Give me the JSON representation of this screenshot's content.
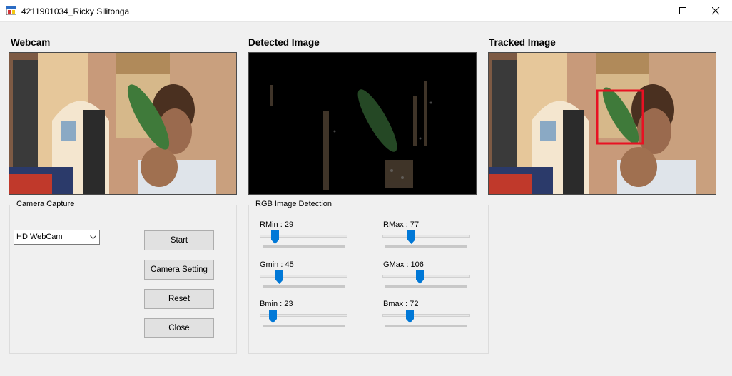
{
  "window": {
    "title": "4211901034_Ricky Silitonga",
    "controls": [
      "minimize-icon",
      "maximize-icon",
      "close-icon"
    ]
  },
  "sections": {
    "webcam": "Webcam",
    "detected": "Detected Image",
    "tracked": "Tracked Image"
  },
  "camera_capture": {
    "legend": "Camera Capture",
    "device_selected": "HD WebCam",
    "buttons": {
      "start": "Start",
      "camera_setting": "Camera Setting",
      "reset": "Reset",
      "close": "Close"
    }
  },
  "rgb_detection": {
    "legend": "RGB Image Detection",
    "sliders": [
      {
        "key": "rmin",
        "label": "RMin : 29",
        "value": 29,
        "max": 255
      },
      {
        "key": "rmax",
        "label": "RMax : 77",
        "value": 77,
        "max": 255
      },
      {
        "key": "gmin",
        "label": "Gmin : 45",
        "value": 45,
        "max": 255
      },
      {
        "key": "gmax",
        "label": "GMax : 106",
        "value": 106,
        "max": 255
      },
      {
        "key": "bmin",
        "label": "Bmin : 23",
        "value": 23,
        "max": 255
      },
      {
        "key": "bmax",
        "label": "Bmax : 72",
        "value": 72,
        "max": 255
      }
    ]
  },
  "colors": {
    "accent": "#0078d7",
    "tracking_box": "#e81123"
  }
}
